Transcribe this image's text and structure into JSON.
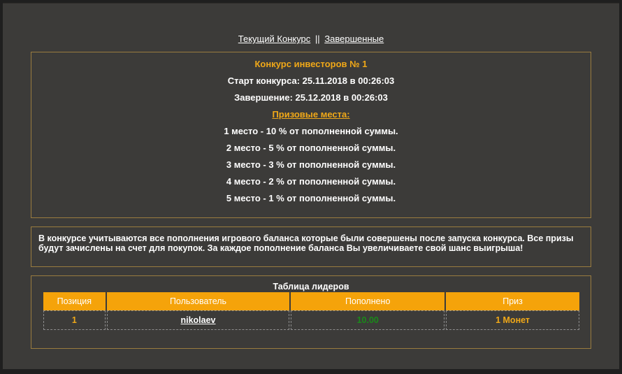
{
  "nav": {
    "current_label": "Текущий Конкурс",
    "separator": "||",
    "finished_label": "Завершенные"
  },
  "contest": {
    "title": "Конкурс инвесторов № 1",
    "start": "Старт конкурса: 25.11.2018 в 00:26:03",
    "end": "Завершение: 25.12.2018 в 00:26:03",
    "prizes_heading": "Призовые места:",
    "prizes": [
      "1 место - 10 % от пополненной суммы.",
      "2 место - 5 % от пополненной суммы.",
      "3 место - 3 % от пополненной суммы.",
      "4 место - 2 % от пополненной суммы.",
      "5 место - 1 % от пополненной суммы."
    ]
  },
  "note": "В конкурсе учитываются все пополнения игрового баланса которые были совершены после запуска конкурса. Все призы будут зачислены на счет для покупок. За каждое пополнение баланса Вы увеличиваете свой шанс выигрыша!",
  "leaders": {
    "title": "Таблица лидеров",
    "columns": [
      "Позиция",
      "Пользователь",
      "Пополнено",
      "Приз"
    ],
    "rows": [
      {
        "position": "1",
        "user": "nikolaev",
        "deposited": "10.00",
        "prize": "1 Монет"
      }
    ]
  },
  "colors": {
    "accent": "#f5a30a",
    "panel": "#3c3b39",
    "border": "#9a7c3f",
    "deposit_green": "#1a8a1a"
  }
}
